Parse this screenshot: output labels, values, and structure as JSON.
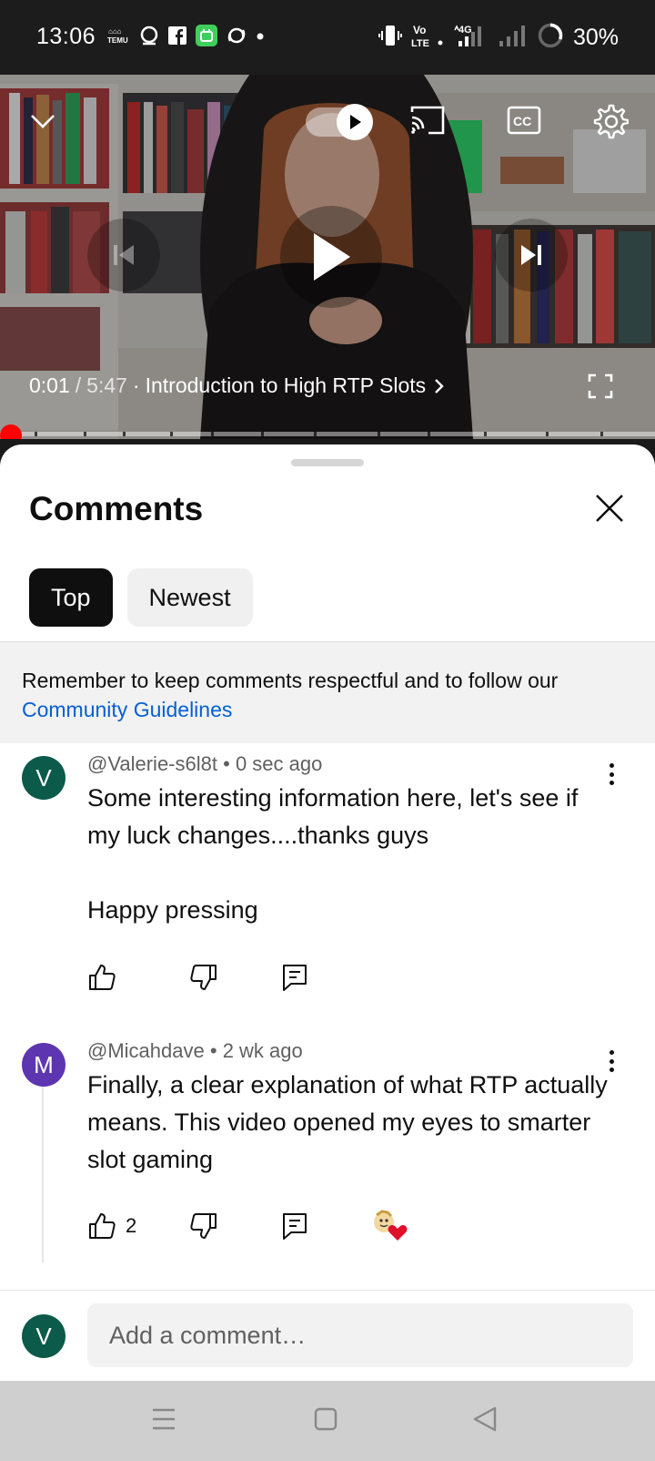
{
  "status_bar": {
    "time": "13:06",
    "battery": "30%",
    "left_icons": [
      "temu-icon",
      "q-app-icon",
      "facebook-icon",
      "notification-app-icon",
      "sync-app-icon",
      "dot-icon"
    ],
    "right_icons": [
      "vibrate-icon",
      "volte-icon",
      "signal-4g-icon",
      "signal-icon",
      "battery-ring-icon"
    ],
    "volte_label": "Vo LTE"
  },
  "player": {
    "current_time": "0:01",
    "separator": "/",
    "duration": "5:47",
    "chapter": "Introduction to High RTP Slots",
    "progress": 0.003,
    "autoplay_on": true
  },
  "comments_sheet": {
    "title": "Comments",
    "tabs": [
      {
        "label": "Top",
        "active": true
      },
      {
        "label": "Newest",
        "active": false
      }
    ],
    "notice_text": "Remember to keep comments respectful and to follow our",
    "notice_link": "Community Guidelines",
    "comments": [
      {
        "avatar_letter": "V",
        "avatar_color": "#0b5a4a",
        "author": "@Valerie-s6l8t",
        "age": "0 sec ago",
        "text": "Some interesting information here, let's see if my luck changes....thanks guys\n\nHappy pressing",
        "likes": ""
      },
      {
        "avatar_letter": "M",
        "avatar_color": "#5e35b1",
        "author": "@Micahdave",
        "age": "2 wk ago",
        "text": "Finally, a clear explanation of what RTP actually means. This video opened my eyes to smarter slot gaming",
        "likes": "2"
      }
    ],
    "add_comment": {
      "avatar_letter": "V",
      "avatar_color": "#0b5a4a",
      "placeholder": "Add a comment…"
    }
  },
  "colors": {
    "accent_red": "#ff0000",
    "link_blue": "#065fd4"
  }
}
